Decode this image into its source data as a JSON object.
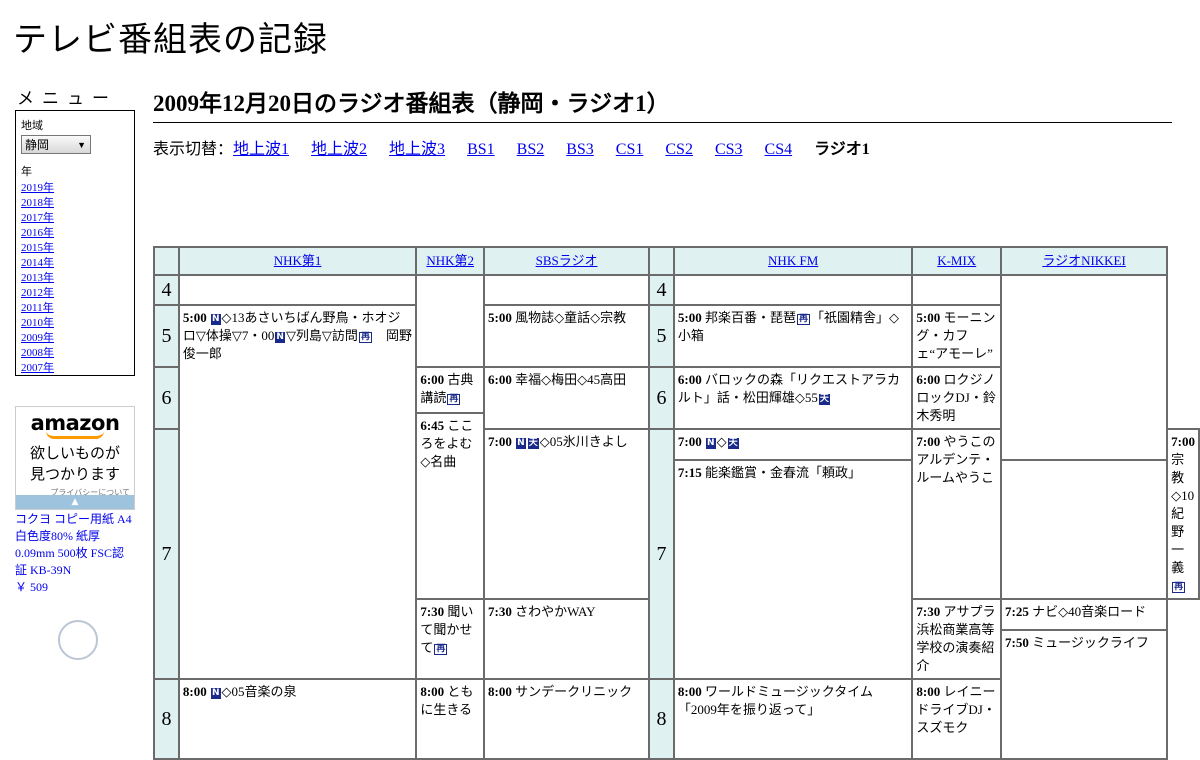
{
  "site": {
    "title": "テレビ番組表の記録"
  },
  "menu": {
    "title": "メニュー",
    "region_label": "地域",
    "region_value": "静岡",
    "year_label": "年",
    "years": [
      "2019年",
      "2018年",
      "2017年",
      "2016年",
      "2015年",
      "2014年",
      "2013年",
      "2012年",
      "2011年",
      "2010年",
      "2009年",
      "2008年",
      "2007年"
    ]
  },
  "ad": {
    "logo": "amazon",
    "copy_line1": "欲しいものが",
    "copy_line2": "見つかります",
    "privacy": "プライバシーについて",
    "product": "コクヨ コピー用紙 A4 白色度80% 紙厚 0.09mm 500枚 FSC認証 KB-39N",
    "price": "￥ 509"
  },
  "page": {
    "title": "2009年12月20日のラジオ番組表（静岡・ラジオ1）"
  },
  "switcher": {
    "label": "表示切替：",
    "links": [
      "地上波1",
      "地上波2",
      "地上波3",
      "BS1",
      "BS2",
      "BS3",
      "CS1",
      "CS2",
      "CS3",
      "CS4"
    ],
    "current": "ラジオ1"
  },
  "channels": [
    "NHK第1",
    "NHK第2",
    "SBSラジオ",
    "NHK FM",
    "K-MIX",
    "ラジオNIKKEI"
  ],
  "hours": [
    "4",
    "5",
    "6",
    "7",
    "8"
  ],
  "marks": {
    "news": "N",
    "rerun": "再",
    "weather": "天"
  },
  "programs": {
    "nhk1_500_time": "5:00",
    "nhk1_500_a": "◇13あさいちばん野鳥・ホオジロ▽体操▽7・00",
    "nhk1_500_b": "▽列島▽訪問",
    "nhk1_500_c": "　岡野俊一郎",
    "nhk1_800_time": "8:00",
    "nhk1_800_a": "◇05音楽の泉",
    "nhk2_600_time": "6:00",
    "nhk2_600_a": "古典講読",
    "nhk2_645_time": "6:45",
    "nhk2_645_a": "こころをよむ◇名曲",
    "nhk2_730_time": "7:30",
    "nhk2_730_a": "聞いて聞かせて",
    "nhk2_800_time": "8:00",
    "nhk2_800_a": "ともに生きる",
    "sbs_500_time": "5:00",
    "sbs_500_a": "風物誌◇童話◇宗教",
    "sbs_600_time": "6:00",
    "sbs_600_a": "幸福◇梅田◇45高田",
    "sbs_700_time": "7:00",
    "sbs_700_a": "◇05氷川きよし",
    "sbs_730_time": "7:30",
    "sbs_730_a": "さわやかWAY",
    "sbs_800_time": "8:00",
    "sbs_800_a": "サンデークリニック",
    "fm_500_time": "5:00",
    "fm_500_a": "邦楽百番・琵琶",
    "fm_500_b": "「祇園精舎」◇小箱",
    "fm_600_time": "6:00",
    "fm_600_a": "バロックの森「リクエストアラカルト」話・松田輝雄◇55",
    "fm_700_time": "7:00",
    "fm_700_a": "◇",
    "fm_715_time": "7:15",
    "fm_715_a": "能楽鑑賞・金春流「頼政」",
    "fm_800_time": "8:00",
    "fm_800_a": "ワールドミュージックタイム「2009年を振り返って」",
    "kmix_500_time": "5:00",
    "kmix_500_a": "モーニング・カフェ“アモーレ”",
    "kmix_600_time": "6:00",
    "kmix_600_a": "ロクジノロックDJ・鈴木秀明",
    "kmix_700_time": "7:00",
    "kmix_700_a": "やうこのアルデンテ・ルームやうこ",
    "kmix_730_time": "7:30",
    "kmix_730_a": "アサプラ浜松商業高等学校の演奏紹介",
    "kmix_800_time": "8:00",
    "kmix_800_a": "レイニードライブDJ・スズモク",
    "nikkei_700_time": "7:00",
    "nikkei_700_a": "宗教◇10紀野一義",
    "nikkei_725_time": "7:25",
    "nikkei_725_a": "ナビ◇40音楽ロード",
    "nikkei_750_time": "7:50",
    "nikkei_750_a": "ミュージックライフ"
  }
}
